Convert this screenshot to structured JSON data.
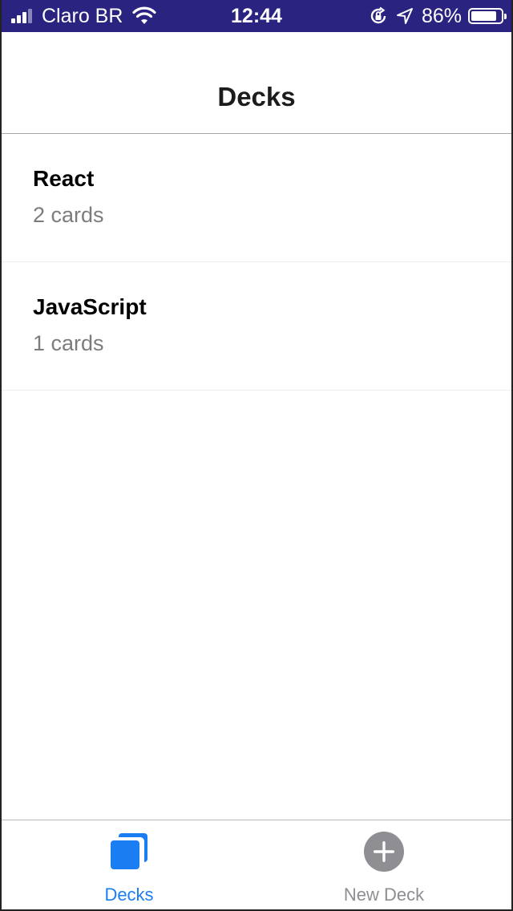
{
  "status_bar": {
    "carrier": "Claro BR",
    "time": "12:44",
    "battery_percent": "86%",
    "battery_level": 0.86
  },
  "header": {
    "title": "Decks"
  },
  "decks": [
    {
      "title": "React",
      "count": "2 cards"
    },
    {
      "title": "JavaScript",
      "count": "1 cards"
    }
  ],
  "tab_bar": {
    "tabs": [
      {
        "label": "Decks",
        "icon": "decks-icon",
        "active": true
      },
      {
        "label": "New Deck",
        "icon": "plus-circle-icon",
        "active": false
      }
    ]
  },
  "colors": {
    "status_bar_bg": "#2a2480",
    "accent": "#1a7ef2",
    "inactive": "#8e8e93"
  }
}
